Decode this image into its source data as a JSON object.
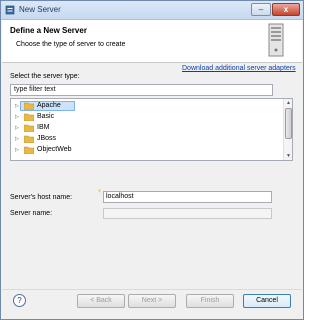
{
  "window": {
    "title": "New Server"
  },
  "header": {
    "title": "Define a New Server",
    "description": "Choose the type of server to create"
  },
  "download_link": "Download additional server adapters",
  "server_type": {
    "label": "Select the server type:",
    "filter_value": "type filter text",
    "tree_items": [
      {
        "label": "Apache",
        "selected": true
      },
      {
        "label": "Basic"
      },
      {
        "label": "IBM"
      },
      {
        "label": "JBoss"
      },
      {
        "label": "ObjectWeb"
      }
    ]
  },
  "host": {
    "label": "Server's host name:",
    "value": "localhost"
  },
  "server_name": {
    "label": "Server name:",
    "value": ""
  },
  "buttons": {
    "help": "?",
    "back": "< Back",
    "next": "Next >",
    "finish": "Finish",
    "cancel": "Cancel"
  },
  "titlebar_buttons": {
    "minimize": "–",
    "close": "x"
  },
  "colors": {
    "accent": "#0b3ea8",
    "folder": "#e8b94a",
    "selection": "#cce3fb"
  }
}
